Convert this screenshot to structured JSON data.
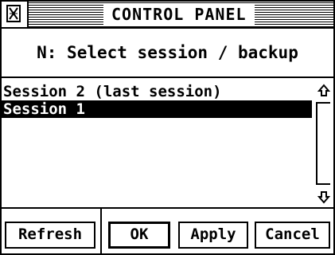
{
  "window": {
    "title": "CONTROL PANEL",
    "close_icon": "close-box-icon"
  },
  "heading": "N: Select session / backup",
  "sessions": [
    {
      "label": "Session 2 (last session)",
      "selected": false
    },
    {
      "label": "Session 1",
      "selected": true
    }
  ],
  "scrollbar": {
    "up_icon": "arrow-up-icon",
    "down_icon": "arrow-down-icon"
  },
  "buttons": {
    "refresh": "Refresh",
    "ok": "OK",
    "apply": "Apply",
    "cancel": "Cancel"
  }
}
